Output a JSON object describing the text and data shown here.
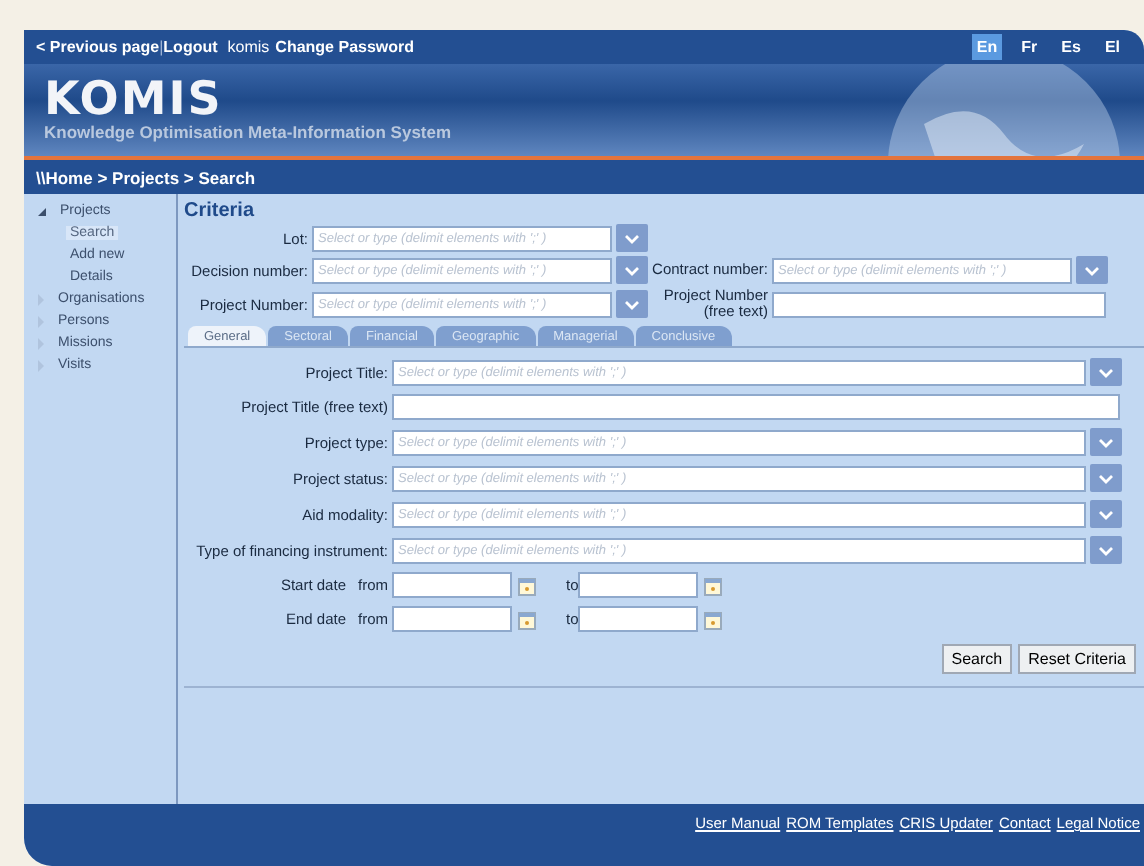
{
  "top_bar": {
    "links": [
      {
        "text": "< Previous page"
      },
      {
        "text": "Logout"
      }
    ],
    "separator": "|",
    "user": "komis",
    "change_password": "Change Password",
    "languages": [
      {
        "label": "En",
        "selected": true
      },
      {
        "label": "Fr",
        "selected": false
      },
      {
        "label": "Es",
        "selected": false
      },
      {
        "label": "El",
        "selected": false
      }
    ]
  },
  "banner": {
    "title": "KOMIS",
    "subtitle": "Knowledge Optimisation Meta-Information System"
  },
  "breadcrumb": "\\\\Home > Projects > Search",
  "sidebar": {
    "items": [
      {
        "label": "Projects",
        "expanded": true,
        "selected": false,
        "children": [
          {
            "label": "Search",
            "selected": true
          },
          {
            "label": "Add new",
            "selected": false
          },
          {
            "label": "Details",
            "selected": false
          }
        ]
      },
      {
        "label": "Organisations",
        "expanded": false,
        "selected": false
      },
      {
        "label": "Persons",
        "expanded": false,
        "selected": false
      },
      {
        "label": "Missions",
        "expanded": false,
        "selected": false
      },
      {
        "label": "Visits",
        "expanded": false,
        "selected": false
      }
    ]
  },
  "criteria": {
    "title": "Criteria",
    "rows": [
      [
        {
          "kind": "combo",
          "label": "Lot:",
          "placeholder": "Select or type (delimit elements with ';' )"
        }
      ],
      [
        {
          "kind": "combo",
          "label": "Decision number:",
          "placeholder": "Select or type (delimit elements with ';' )"
        },
        {
          "kind": "combo",
          "label": "Contract number:",
          "placeholder": "Select or type (delimit elements with ';' )"
        }
      ],
      [
        {
          "kind": "combo",
          "label": "Project Number:",
          "placeholder": "Select or type (delimit elements with ';' )"
        },
        {
          "kind": "text",
          "label": "Project Number",
          "sublabel": "(free text)"
        }
      ]
    ]
  },
  "tabs": [
    {
      "label": "General",
      "selected": true
    },
    {
      "label": "Sectoral",
      "selected": false
    },
    {
      "label": "Financial",
      "selected": false
    },
    {
      "label": "Geographic",
      "selected": false
    },
    {
      "label": "Managerial",
      "selected": false
    },
    {
      "label": "Conclusive",
      "selected": false
    }
  ],
  "fields": [
    {
      "kind": "combo",
      "label": "Project Title:",
      "placeholder": "Select or type (delimit elements with ';' )"
    },
    {
      "kind": "text",
      "label": "Project Title (free text)"
    },
    {
      "kind": "combo",
      "label": "Project type:",
      "placeholder": "Select or type (delimit elements with ';' )"
    },
    {
      "kind": "combo",
      "label": "Project status:",
      "placeholder": "Select or type (delimit elements with ';' )"
    },
    {
      "kind": "combo",
      "label": "Aid modality:",
      "placeholder": "Select or type (delimit elements with ';' )"
    },
    {
      "kind": "combo",
      "label": "Type of financing instrument:",
      "placeholder": "Select or type (delimit elements with ';' )"
    },
    {
      "kind": "daterange",
      "label": "Start date",
      "from": "from",
      "to": "to"
    },
    {
      "kind": "daterange",
      "label": "End date",
      "from": "from",
      "to": "to"
    }
  ],
  "buttons": [
    "Search",
    "Reset Criteria"
  ],
  "footer": {
    "links": [
      "User Manual",
      "ROM Templates",
      "CRIS Updater",
      "Contact",
      "Legal Notice"
    ]
  }
}
